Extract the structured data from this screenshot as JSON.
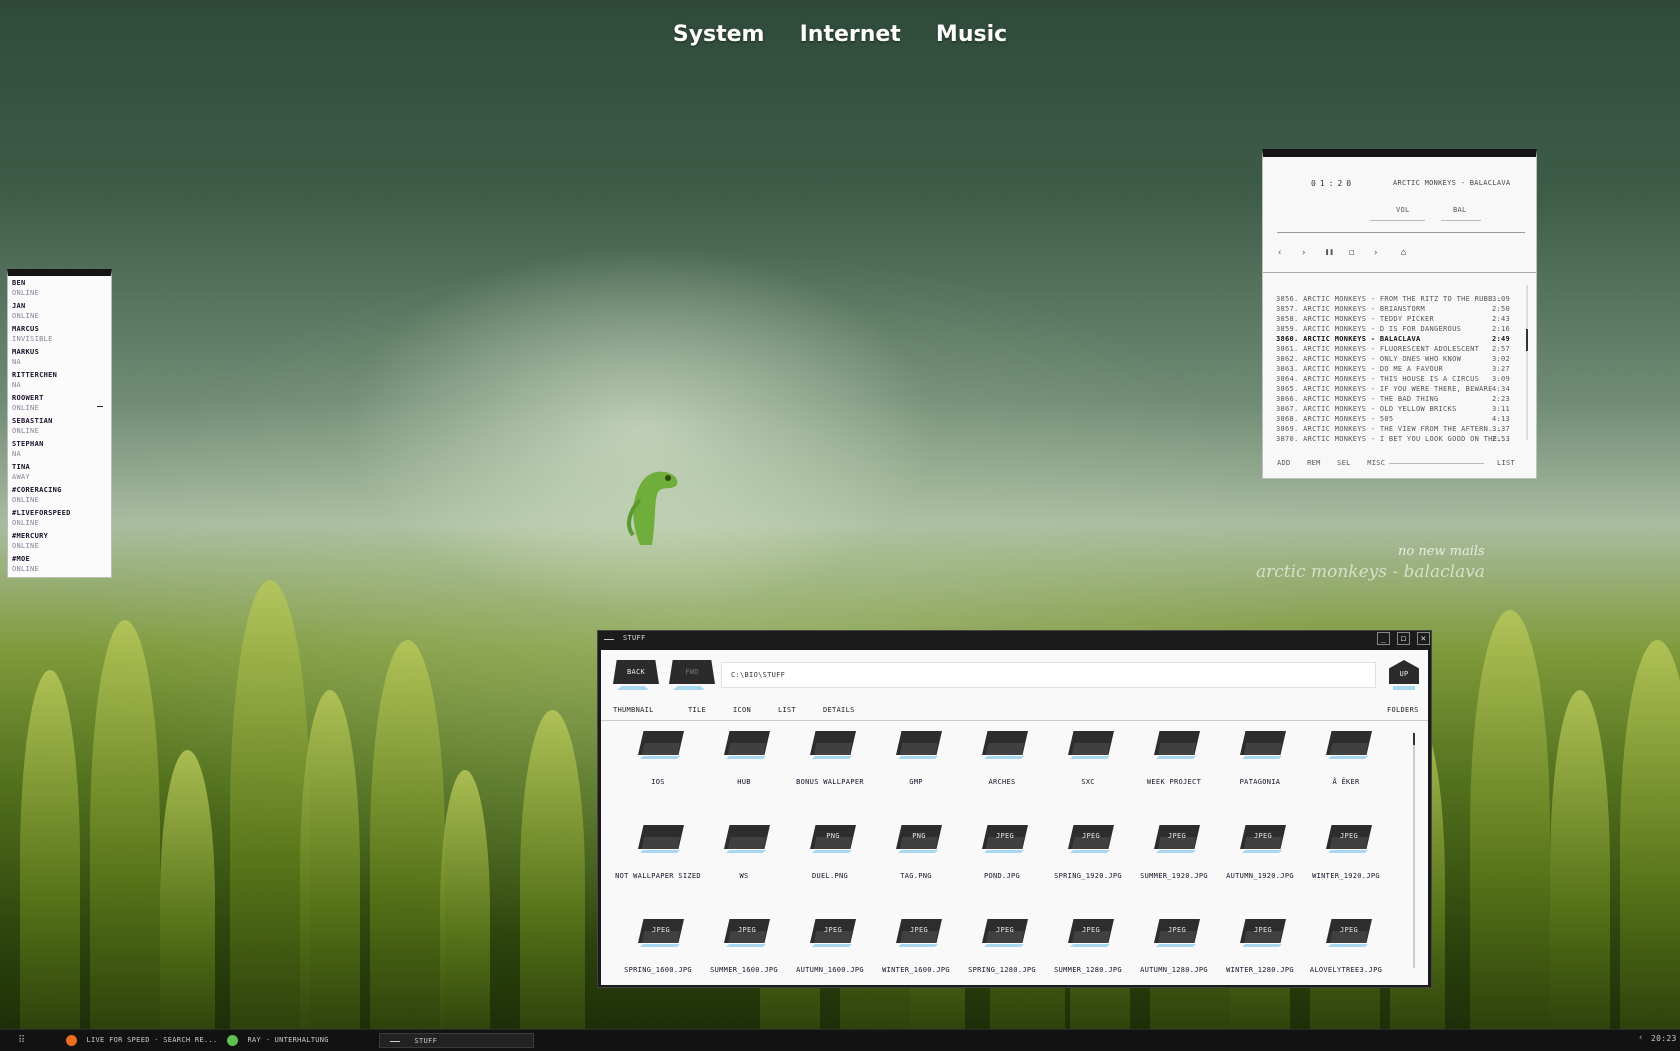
{
  "top_menu": [
    "System",
    "Internet",
    "Music"
  ],
  "contacts": [
    {
      "name": "Ben",
      "status": "online"
    },
    {
      "name": "Jan",
      "status": "online"
    },
    {
      "name": "Marcus",
      "status": "invisible"
    },
    {
      "name": "Markus",
      "status": "NA"
    },
    {
      "name": "Ritterchen",
      "status": "NA"
    },
    {
      "name": "Roowert",
      "status": "online"
    },
    {
      "name": "Sebastian",
      "status": "online"
    },
    {
      "name": "Stephan",
      "status": "NA"
    },
    {
      "name": "Tina",
      "status": "away"
    },
    {
      "name": "#CoreRacing",
      "status": "online"
    },
    {
      "name": "#LiveForSpeed",
      "status": "online"
    },
    {
      "name": "#Mercury",
      "status": "online"
    },
    {
      "name": "#Moe",
      "status": "online"
    }
  ],
  "player": {
    "time": "01:20",
    "now_playing": "Arctic Monkeys - Balaclava",
    "vol_label": "VOL",
    "bal_label": "BAL",
    "controls": [
      "‹",
      "›",
      "❚❚",
      "◻",
      "›",
      "⌂"
    ],
    "playlist": [
      {
        "n": "3856.",
        "title": "Arctic Monkeys - From the Ritz to the Rubb...",
        "t": "3:09"
      },
      {
        "n": "3857.",
        "title": "Arctic Monkeys - Brianstorm",
        "t": "2:50"
      },
      {
        "n": "3858.",
        "title": "Arctic Monkeys - Teddy Picker",
        "t": "2:43"
      },
      {
        "n": "3859.",
        "title": "Arctic Monkeys - D is for Dangerous",
        "t": "2:16"
      },
      {
        "n": "3860.",
        "title": "Arctic Monkeys - Balaclava",
        "t": "2:49",
        "current": true
      },
      {
        "n": "3861.",
        "title": "Arctic Monkeys - Fluorescent Adolescent",
        "t": "2:57"
      },
      {
        "n": "3862.",
        "title": "Arctic Monkeys - Only Ones Who Know",
        "t": "3:02"
      },
      {
        "n": "3863.",
        "title": "Arctic Monkeys - Do Me a Favour",
        "t": "3:27"
      },
      {
        "n": "3864.",
        "title": "Arctic Monkeys - This House is a Circus",
        "t": "3:09"
      },
      {
        "n": "3865.",
        "title": "Arctic Monkeys - If You Were There, Beware",
        "t": "4:34"
      },
      {
        "n": "3866.",
        "title": "Arctic Monkeys - The Bad Thing",
        "t": "2:23"
      },
      {
        "n": "3867.",
        "title": "Arctic Monkeys - Old Yellow Bricks",
        "t": "3:11"
      },
      {
        "n": "3868.",
        "title": "Arctic Monkeys - 505",
        "t": "4:13"
      },
      {
        "n": "3869.",
        "title": "Arctic Monkeys - The View from the Aftern...",
        "t": "3:37"
      },
      {
        "n": "3870.",
        "title": "Arctic Monkeys - I Bet You Look Good on the...",
        "t": "2:53"
      }
    ],
    "bottom": {
      "add": "ADD",
      "rem": "REM",
      "sel": "SEL",
      "misc": "MISC",
      "list": "LIST"
    }
  },
  "overlay": {
    "mail": "no new mails",
    "now_playing": "arctic monkeys - balaclava"
  },
  "file_window": {
    "title": "Stuff",
    "back": "BACK",
    "forward": "FWD",
    "up": "UP",
    "address": "C:\\BIO\\STUFF",
    "views": [
      "Thumbnail",
      "Tile",
      "Icon",
      "List",
      "Details"
    ],
    "folders": "Folders",
    "items": [
      {
        "name": "ios",
        "ext": ""
      },
      {
        "name": "hub",
        "ext": ""
      },
      {
        "name": "Bonus Wallpaper",
        "ext": ""
      },
      {
        "name": "GMP",
        "ext": ""
      },
      {
        "name": "arches",
        "ext": ""
      },
      {
        "name": "SXC",
        "ext": ""
      },
      {
        "name": "week project",
        "ext": ""
      },
      {
        "name": "patagonia",
        "ext": ""
      },
      {
        "name": "å êker",
        "ext": ""
      },
      {
        "name": "not wallpaper sized",
        "ext": ""
      },
      {
        "name": "WS",
        "ext": ""
      },
      {
        "name": "duel.png",
        "ext": "PNG"
      },
      {
        "name": "tag.png",
        "ext": "PNG"
      },
      {
        "name": "pond.jpg",
        "ext": "JPEG"
      },
      {
        "name": "spring_1920.jpg",
        "ext": "JPEG"
      },
      {
        "name": "summer_1920.jpg",
        "ext": "JPEG"
      },
      {
        "name": "autumn_1920.jpg",
        "ext": "JPEG"
      },
      {
        "name": "winter_1920.jpg",
        "ext": "JPEG"
      },
      {
        "name": "spring_1600.jpg",
        "ext": "JPEG"
      },
      {
        "name": "summer_1600.jpg",
        "ext": "JPEG"
      },
      {
        "name": "autumn_1600.jpg",
        "ext": "JPEG"
      },
      {
        "name": "winter_1600.jpg",
        "ext": "JPEG"
      },
      {
        "name": "spring_1280.jpg",
        "ext": "JPEG"
      },
      {
        "name": "summer_1280.jpg",
        "ext": "JPEG"
      },
      {
        "name": "autumn_1280.jpg",
        "ext": "JPEG"
      },
      {
        "name": "winter_1280.jpg",
        "ext": "JPEG"
      },
      {
        "name": "alovelytree3.jpg",
        "ext": "JPEG"
      }
    ]
  },
  "taskbar": {
    "tasks": [
      {
        "label": "Live For Speed - Search Re...",
        "icon": "firefox-icon",
        "color": "#e8701e"
      },
      {
        "label": "Ray - Unterhaltung",
        "icon": "messenger-icon",
        "color": "#5fbf4f"
      },
      {
        "label": "Stuff",
        "active": true
      }
    ],
    "clock": "20:23"
  }
}
